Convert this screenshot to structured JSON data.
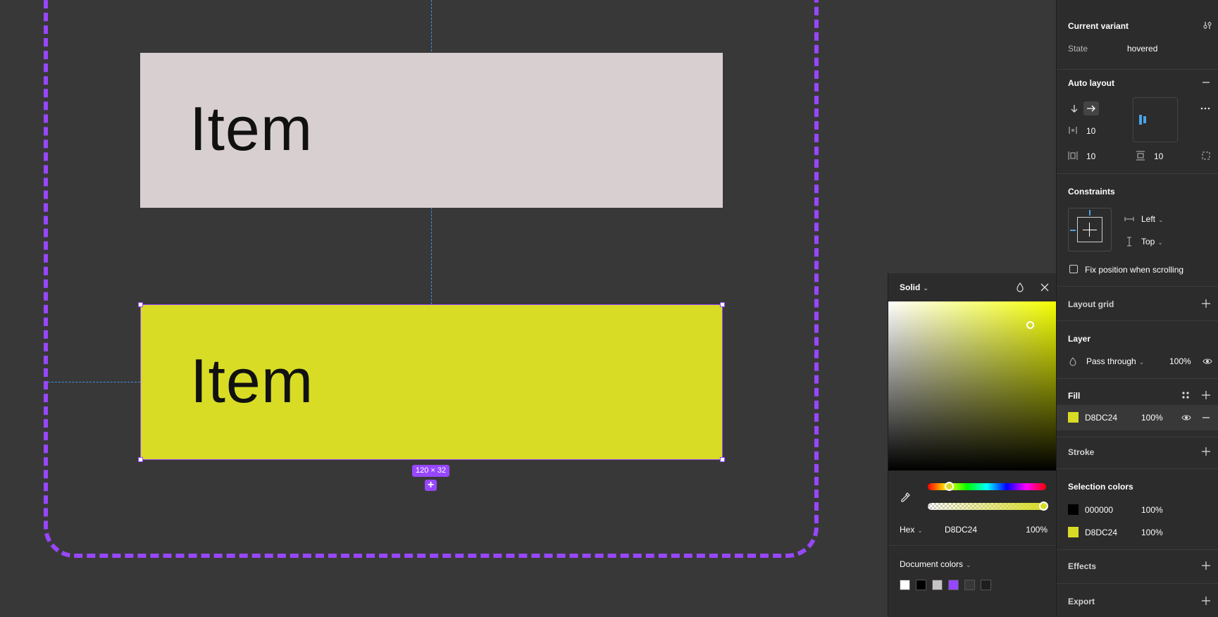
{
  "canvas": {
    "items": [
      {
        "label": "Item",
        "state": "default",
        "color": "#d8d0d0"
      },
      {
        "label": "Item",
        "state": "hovered",
        "color": "#d8dc24"
      }
    ],
    "size_badge": "120 × 32",
    "frame_color": "#9747ff"
  },
  "color_picker": {
    "fill_type": "Solid",
    "hex_mode": "Hex",
    "hex_value": "D8DC24",
    "alpha": "100%",
    "document_colors_label": "Document colors",
    "document_colors": [
      "#ffffff",
      "#000000",
      "#c8c4c4",
      "#9747ff",
      "#383838",
      "#1e1e1e"
    ]
  },
  "panel": {
    "current_variant": {
      "title": "Current variant",
      "state_label": "State",
      "state_value": "hovered"
    },
    "auto_layout": {
      "title": "Auto layout",
      "spacing": "10",
      "padding_h": "10",
      "padding_v": "10"
    },
    "constraints": {
      "title": "Constraints",
      "horizontal": "Left",
      "vertical": "Top",
      "fix_position_label": "Fix position when scrolling"
    },
    "layout_grid": {
      "title": "Layout grid"
    },
    "layer": {
      "title": "Layer",
      "blend_mode": "Pass through",
      "opacity": "100%"
    },
    "fill": {
      "title": "Fill",
      "hex": "D8DC24",
      "opacity": "100%",
      "color": "#d8dc24"
    },
    "stroke": {
      "title": "Stroke"
    },
    "selection_colors": {
      "title": "Selection colors",
      "items": [
        {
          "hex": "000000",
          "opacity": "100%",
          "color": "#000000"
        },
        {
          "hex": "D8DC24",
          "opacity": "100%",
          "color": "#d8dc24"
        }
      ]
    },
    "effects": {
      "title": "Effects"
    },
    "export": {
      "title": "Export"
    }
  }
}
